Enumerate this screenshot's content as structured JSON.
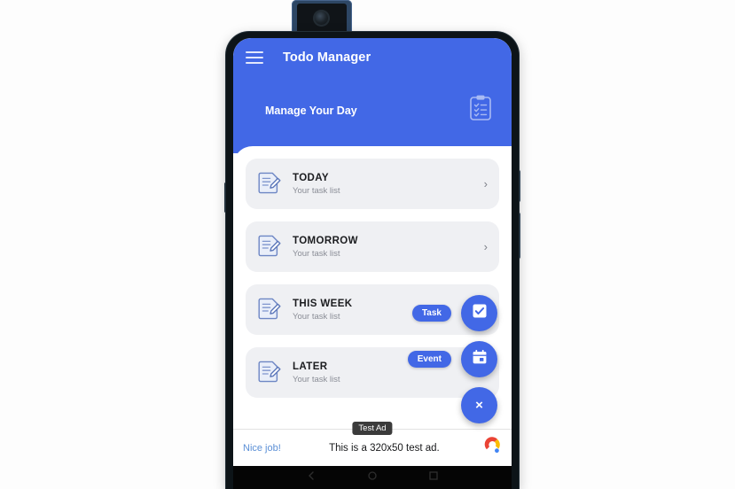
{
  "app": {
    "title": "Todo Manager",
    "menu_icon": "hamburger-menu-icon",
    "hero_title": "Manage Your Day",
    "hero_icon": "clipboard-checklist-icon",
    "header_color": "#4268e6",
    "sheet_color": "#ffffff",
    "card_color": "#eff0f3"
  },
  "task_lists": [
    {
      "title": "TODAY",
      "subtitle": "Your task list",
      "icon": "note-pencil-icon",
      "chevron": "›"
    },
    {
      "title": "TOMORROW",
      "subtitle": "Your task list",
      "icon": "note-pencil-icon",
      "chevron": "›"
    },
    {
      "title": "THIS WEEK",
      "subtitle": "Your task list",
      "icon": "note-pencil-icon",
      "chevron": "›"
    },
    {
      "title": "LATER",
      "subtitle": "Your task list",
      "icon": "note-pencil-icon",
      "chevron": "›"
    }
  ],
  "speed_dial": {
    "expanded": true,
    "actions": [
      {
        "label": "Task",
        "icon": "checkbox-checked-icon"
      },
      {
        "label": "Event",
        "icon": "calendar-icon"
      }
    ],
    "main_label": "×",
    "main_icon": "close-icon",
    "color": "#4268e6"
  },
  "ad_banner": {
    "badge": "Test Ad",
    "link_text": "Nice job!",
    "body_text": "This is a 320x50 test ad.",
    "logo": "admob-logo"
  },
  "device": {
    "camera": "popup-selfie-camera",
    "nav_buttons": [
      "back-nav-icon",
      "home-nav-icon",
      "recents-nav-icon"
    ]
  }
}
